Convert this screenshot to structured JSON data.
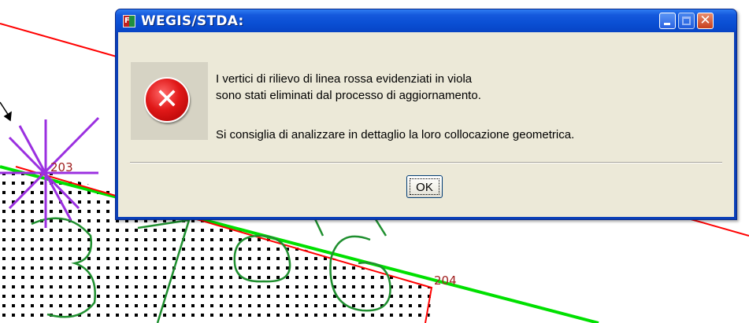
{
  "map": {
    "point_labels": [
      "203",
      "204"
    ]
  },
  "dialog": {
    "title": "WEGIS/STDA:",
    "app_icon_letter": "F",
    "icon": "error-icon",
    "message_lines": [
      "I vertici di rilievo di linea rossa evidenziati in viola",
      "sono stati eliminati dal processo di aggiornamento.",
      "Si consiglia di analizzare in dettaglio la loro collocazione geometrica."
    ],
    "ok_label": "OK",
    "buttons": {
      "minimize": "minimize-icon",
      "maximize": "maximize-icon",
      "close": "close-icon"
    }
  },
  "colors": {
    "titlebar": "#0a4fd4",
    "dialog_face": "#ece9d8",
    "error_red": "#e01818",
    "map_red_line": "#ff0000",
    "map_green_line": "#00e000",
    "map_contour": "#1f8f2f",
    "map_vertex": "#9b30e0"
  }
}
